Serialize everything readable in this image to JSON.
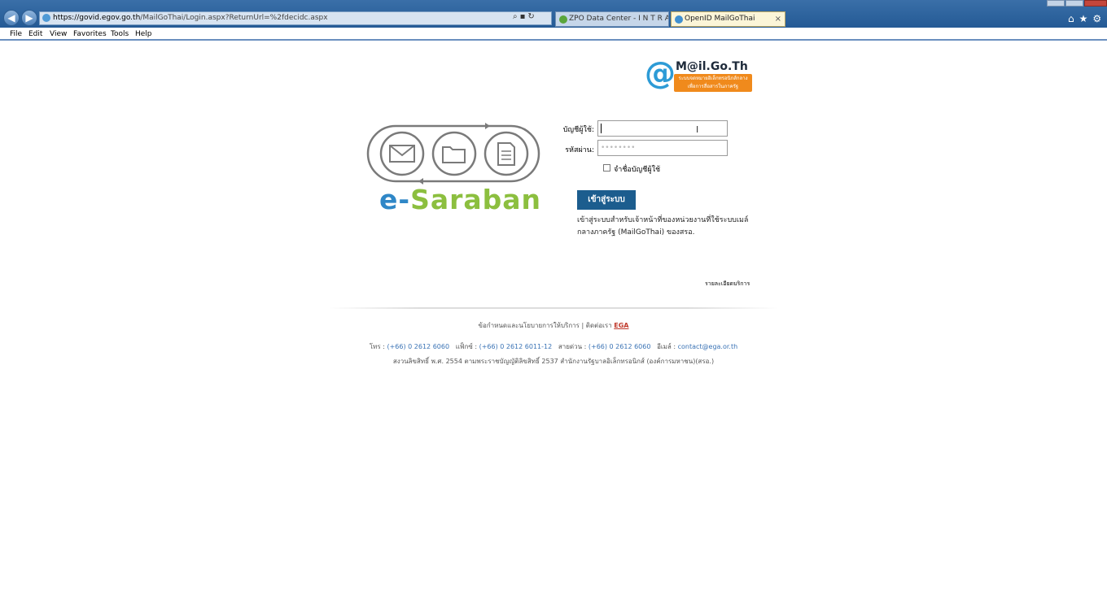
{
  "browser": {
    "url_host": "https://govid.egov.go.th",
    "url_path": "/MailGoThai/Login.aspx?ReturnUrl=%2fdecidc.aspx",
    "tabs": [
      {
        "label": "ZPO Data Center - I N T R A N ..."
      },
      {
        "label": "OpenID MailGoThai"
      }
    ],
    "close_tab": "×"
  },
  "menubar": {
    "items": [
      "File",
      "Edit",
      "View",
      "Favorites",
      "Tools",
      "Help"
    ]
  },
  "brand": {
    "mail_logo_at": "@",
    "mail_logo_name": "M@il.Go.Th",
    "mail_logo_tag_1": "ระบบจดหมายอิเล็กทรอนิกส์กลาง",
    "mail_logo_tag_2": "เพื่อการสื่อสารในภาครัฐ",
    "saraban_e": "e-",
    "saraban_rest": "Saraban"
  },
  "login": {
    "username_label": "บัญชีผู้ใช้:",
    "password_label": "รหัสผ่าน:",
    "password_placeholder": "••••••••",
    "remember_label": "จำชื่อบัญชีผู้ใช้",
    "submit_label": "เข้าสู่ระบบ",
    "description": "เข้าสู่ระบบสำหรับเจ้าหน้าที่ของหน่วยงานที่ใช้ระบบเมล์กลางภาครัฐ (MailGoThai) ของสรอ.",
    "terms_link": "รายละเอียดบริการ"
  },
  "footer": {
    "policy_text": "ข้อกำหนดและนโยบายการให้บริการ",
    "separator": "|",
    "contact_text": "ติดต่อเรา",
    "ega": "EGA",
    "phone_label": "โทร :",
    "phone": "(+66) 0 2612 6060",
    "fax_label": "แฟ็กซ์ :",
    "fax": "(+66) 0 2612 6011-12",
    "hotline_label": "สายด่วน :",
    "hotline": "(+66) 0 2612 6060",
    "email_label": "อีเมล์ :",
    "email": "contact@ega.or.th",
    "copyright": "สงวนลิขสิทธิ์ พ.ศ. 2554 ตามพระราชบัญญัติลิขสิทธิ์ 2537 สำนักงานรัฐบาลอิเล็กทรอนิกส์ (องค์การมหาชน)(สรอ.)"
  }
}
